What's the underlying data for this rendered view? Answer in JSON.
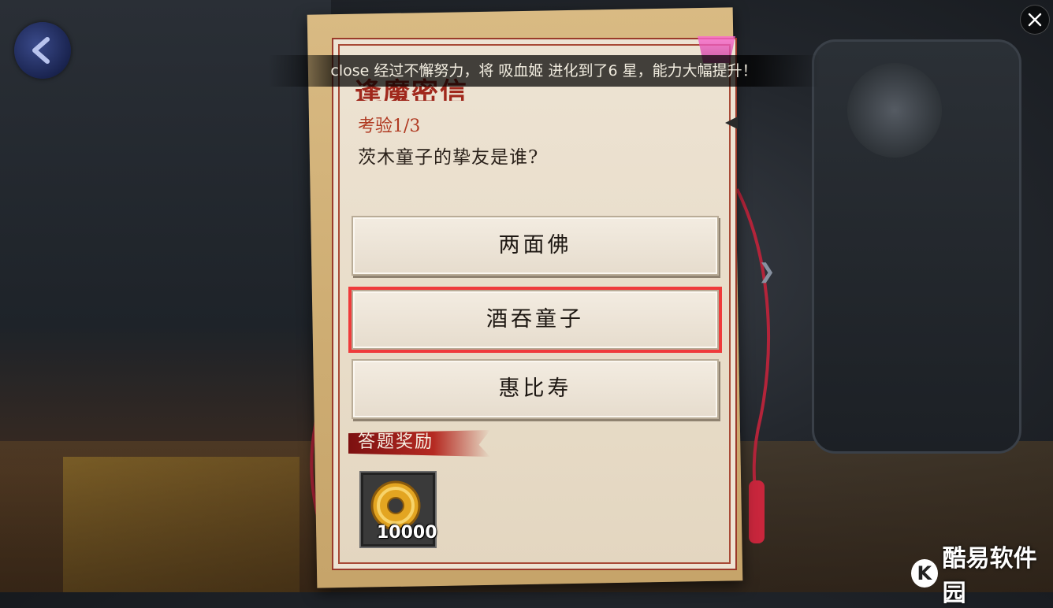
{
  "notice": {
    "text": "close 经过不懈努力，将 吸血姬 进化到了6 星，能力大幅提升！"
  },
  "panel": {
    "title_partial": "逢魔密信",
    "stage": "考验1/3",
    "question": "茨木童子的挚友是谁?",
    "options": [
      {
        "label": "两面佛",
        "selected": false
      },
      {
        "label": "酒吞童子",
        "selected": true
      },
      {
        "label": "惠比寿",
        "selected": false
      }
    ],
    "reward": {
      "label": "答题奖励",
      "item_icon": "gold-coin-icon",
      "item_count": "10000"
    }
  },
  "watermark": {
    "logo": "K",
    "text": "酷易软件园"
  },
  "colors": {
    "highlight": "#ef3b3b",
    "accent_red": "#a0281c",
    "paper": "#ede3d3"
  }
}
